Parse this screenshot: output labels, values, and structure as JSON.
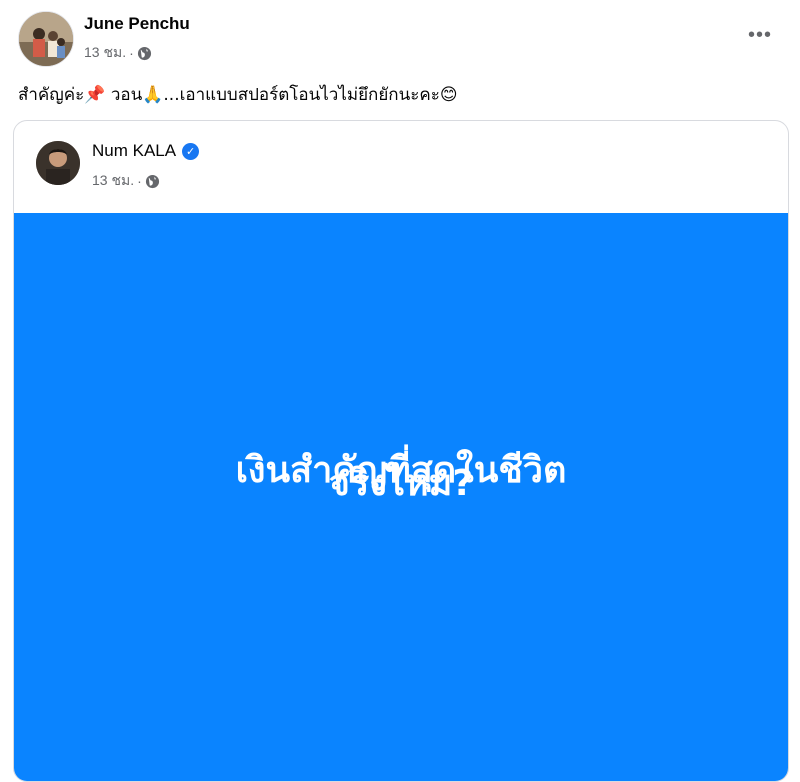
{
  "post": {
    "author": "June Penchu",
    "time": "13 ชม.",
    "separator": "·",
    "more_label": "•••",
    "caption": "สำคัญค่ะ📌 วอน🙏...เอาแบบสปอร์ตโอนไวไม่ยึกยักนะคะ😊"
  },
  "shared_post": {
    "author": "Num KALA",
    "verified": "✓",
    "time": "13 ชม.",
    "separator": "·",
    "text_line1": "เงินสำคัญที่สุดในชีวิต",
    "text_line2": "จริงไหม?",
    "background_color": "#0A84FF"
  },
  "icons": {
    "audience": "globe-icon",
    "verified": "verified-badge-icon",
    "more": "more-options-icon"
  }
}
